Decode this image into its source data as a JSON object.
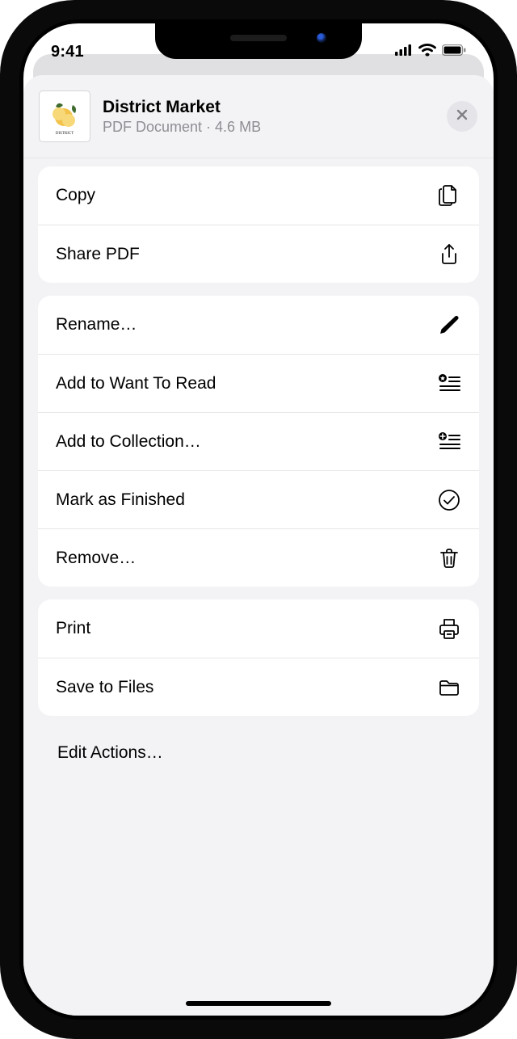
{
  "status": {
    "time": "9:41"
  },
  "document": {
    "title": "District Market",
    "type": "PDF Document",
    "size": "4.6 MB"
  },
  "actions": {
    "copy": "Copy",
    "share_pdf": "Share PDF",
    "rename": "Rename…",
    "add_want_to_read": "Add to Want To Read",
    "add_collection": "Add to Collection…",
    "mark_finished": "Mark as Finished",
    "remove": "Remove…",
    "print": "Print",
    "save_files": "Save to Files",
    "edit_actions": "Edit Actions…"
  }
}
